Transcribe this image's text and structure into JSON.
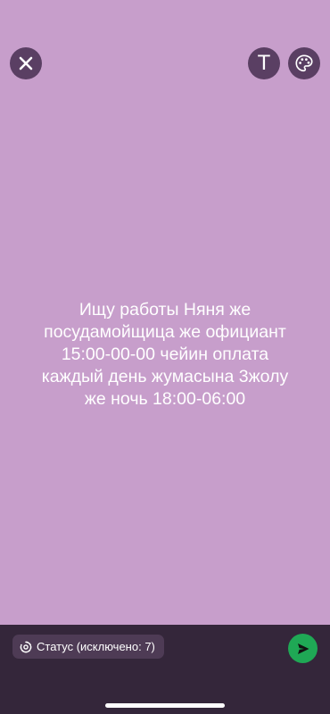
{
  "colors": {
    "background": "#c79ecb",
    "bottom_bar": "#34263a",
    "button_bg": "#5a3f63",
    "chip_bg": "#4e3b55",
    "send_green": "#1fa855",
    "text": "#ffffff"
  },
  "toolbar": {
    "close_icon": "close-icon",
    "text_label": "T",
    "palette_icon": "palette-icon"
  },
  "status": {
    "text": "Ищу работы Няня же\nпосудамойщица же официант\n15:00-00-00 чейин оплата\nкаждый день жумасына 3жолу\nже ночь 18:00-06:00"
  },
  "footer": {
    "privacy_icon": "status-privacy-icon",
    "chip_label": "Статус (исключено: 7)",
    "send_icon": "send-icon"
  }
}
